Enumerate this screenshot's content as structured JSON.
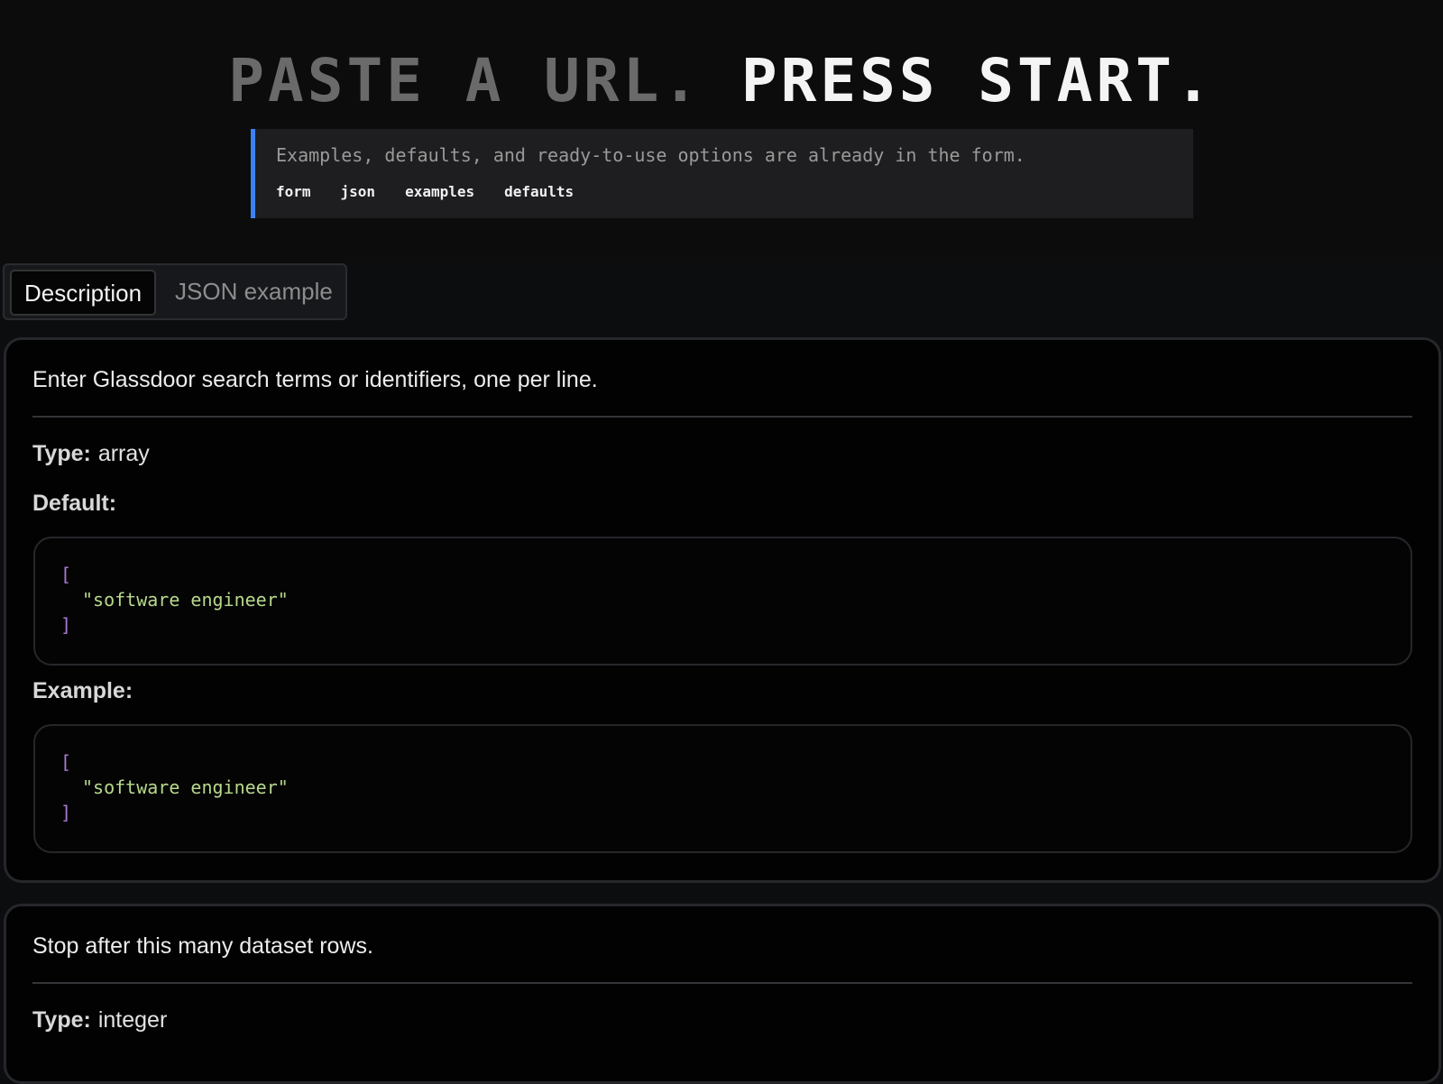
{
  "hero": {
    "title_dim": "PASTE A URL. ",
    "title_bright": "PRESS START.",
    "callout_text": "Examples, defaults, and ready-to-use options are already in the form.",
    "links": [
      "form",
      "json",
      "examples",
      "defaults"
    ]
  },
  "tabs": [
    {
      "label": "Description",
      "active": true
    },
    {
      "label": "JSON example",
      "active": false
    }
  ],
  "fields": [
    {
      "description": "Enter Glassdoor search terms or identifiers, one per line.",
      "type_label": "Type:",
      "type_value": "array",
      "default_label": "Default:",
      "default_code": {
        "open": "[",
        "value": "\"software engineer\"",
        "close": "]"
      },
      "example_label": "Example:",
      "example_code": {
        "open": "[",
        "value": "\"software engineer\"",
        "close": "]"
      }
    },
    {
      "description": "Stop after this many dataset rows.",
      "type_label": "Type:",
      "type_value": "integer"
    }
  ],
  "colors": {
    "accent": "#3b82f6",
    "bracket": "#a77bd6",
    "string": "#b7d98c"
  }
}
